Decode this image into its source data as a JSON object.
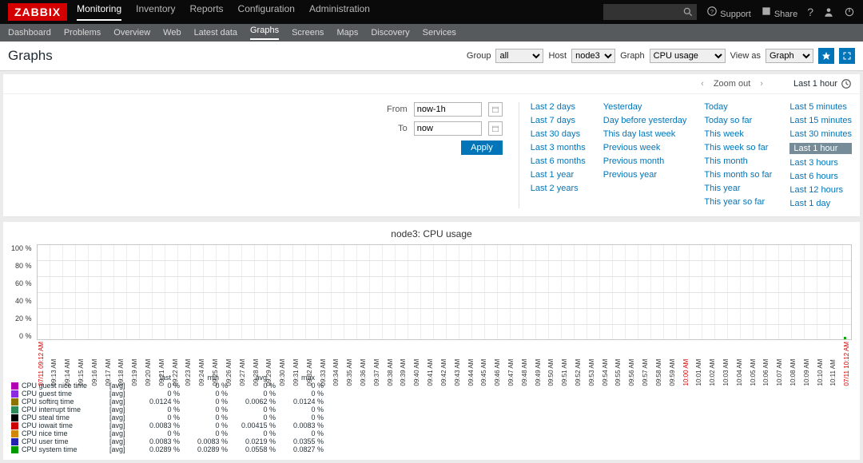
{
  "brand": "ZABBIX",
  "topnav": [
    "Monitoring",
    "Inventory",
    "Reports",
    "Configuration",
    "Administration"
  ],
  "topnav_active": 0,
  "toptools": {
    "support": "Support",
    "share": "Share"
  },
  "subnav": [
    "Dashboard",
    "Problems",
    "Overview",
    "Web",
    "Latest data",
    "Graphs",
    "Screens",
    "Maps",
    "Discovery",
    "Services"
  ],
  "subnav_active": 5,
  "page_title": "Graphs",
  "filters": {
    "group_lbl": "Group",
    "group_val": "all",
    "host_lbl": "Host",
    "host_val": "node3",
    "graph_lbl": "Graph",
    "graph_val": "CPU usage",
    "viewas_lbl": "View as",
    "viewas_val": "Graph"
  },
  "timesel": {
    "zoomout": "Zoom out",
    "current": "Last 1 hour"
  },
  "fromto": {
    "from_lbl": "From",
    "from_val": "now-1h",
    "to_lbl": "To",
    "to_val": "now",
    "apply": "Apply"
  },
  "presets": [
    [
      "Last 2 days",
      "Last 7 days",
      "Last 30 days",
      "Last 3 months",
      "Last 6 months",
      "Last 1 year",
      "Last 2 years"
    ],
    [
      "Yesterday",
      "Day before yesterday",
      "This day last week",
      "Previous week",
      "Previous month",
      "Previous year"
    ],
    [
      "Today",
      "Today so far",
      "This week",
      "This week so far",
      "This month",
      "This month so far",
      "This year",
      "This year so far"
    ],
    [
      "Last 5 minutes",
      "Last 15 minutes",
      "Last 30 minutes",
      "Last 1 hour",
      "Last 3 hours",
      "Last 6 hours",
      "Last 12 hours",
      "Last 1 day"
    ]
  ],
  "preset_selected": "Last 1 hour",
  "chart_data": {
    "type": "line",
    "title": "node3: CPU usage",
    "ylabel": "%",
    "ylim": [
      0,
      100
    ],
    "yticks": [
      "100 %",
      "80 %",
      "60 %",
      "40 %",
      "20 %",
      "0 %"
    ],
    "xticks": [
      "07/11 09:12 AM",
      "09:13 AM",
      "09:14 AM",
      "09:15 AM",
      "09:16 AM",
      "09:17 AM",
      "09:18 AM",
      "09:19 AM",
      "09:20 AM",
      "09:21 AM",
      "09:22 AM",
      "09:23 AM",
      "09:24 AM",
      "09:25 AM",
      "09:26 AM",
      "09:27 AM",
      "09:28 AM",
      "09:29 AM",
      "09:30 AM",
      "09:31 AM",
      "09:32 AM",
      "09:33 AM",
      "09:34 AM",
      "09:35 AM",
      "09:36 AM",
      "09:37 AM",
      "09:38 AM",
      "09:39 AM",
      "09:40 AM",
      "09:41 AM",
      "09:42 AM",
      "09:43 AM",
      "09:44 AM",
      "09:45 AM",
      "09:46 AM",
      "09:47 AM",
      "09:48 AM",
      "09:49 AM",
      "09:50 AM",
      "09:51 AM",
      "09:52 AM",
      "09:53 AM",
      "09:54 AM",
      "09:55 AM",
      "09:56 AM",
      "09:57 AM",
      "09:58 AM",
      "09:59 AM",
      "10:00 AM",
      "10:01 AM",
      "10:02 AM",
      "10:03 AM",
      "10:04 AM",
      "10:05 AM",
      "10:06 AM",
      "10:07 AM",
      "10:08 AM",
      "10:09 AM",
      "10:10 AM",
      "10:11 AM",
      "07/11 10:12 AM"
    ],
    "xticks_red": [
      0,
      48,
      60
    ],
    "legend_headers": [
      "last",
      "min",
      "avg",
      "max"
    ],
    "series": [
      {
        "name": "CPU guest nice time",
        "color": "#b300b3",
        "agg": "[avg]",
        "last": "0 %",
        "min": "0 %",
        "avg": "0 %",
        "max": "0 %"
      },
      {
        "name": "CPU guest time",
        "color": "#8a2be2",
        "agg": "[avg]",
        "last": "0 %",
        "min": "0 %",
        "avg": "0 %",
        "max": "0 %"
      },
      {
        "name": "CPU softirq time",
        "color": "#8b7500",
        "agg": "[avg]",
        "last": "0.0124 %",
        "min": "0 %",
        "avg": "0.0062 %",
        "max": "0.0124 %"
      },
      {
        "name": "CPU interrupt time",
        "color": "#2e8b57",
        "agg": "[avg]",
        "last": "0 %",
        "min": "0 %",
        "avg": "0 %",
        "max": "0 %"
      },
      {
        "name": "CPU steal time",
        "color": "#000000",
        "agg": "[avg]",
        "last": "0 %",
        "min": "0 %",
        "avg": "0 %",
        "max": "0 %"
      },
      {
        "name": "CPU iowait time",
        "color": "#cc0000",
        "agg": "[avg]",
        "last": "0.0083 %",
        "min": "0 %",
        "avg": "0.00415 %",
        "max": "0.0083 %"
      },
      {
        "name": "CPU nice time",
        "color": "#d0870a",
        "agg": "[avg]",
        "last": "0 %",
        "min": "0 %",
        "avg": "0 %",
        "max": "0 %"
      },
      {
        "name": "CPU user time",
        "color": "#2323b0",
        "agg": "[avg]",
        "last": "0.0083 %",
        "min": "0.0083 %",
        "avg": "0.0219 %",
        "max": "0.0355 %"
      },
      {
        "name": "CPU system time",
        "color": "#009900",
        "agg": "[avg]",
        "last": "0.0289 %",
        "min": "0.0289 %",
        "avg": "0.0558 %",
        "max": "0.0827 %"
      }
    ]
  }
}
